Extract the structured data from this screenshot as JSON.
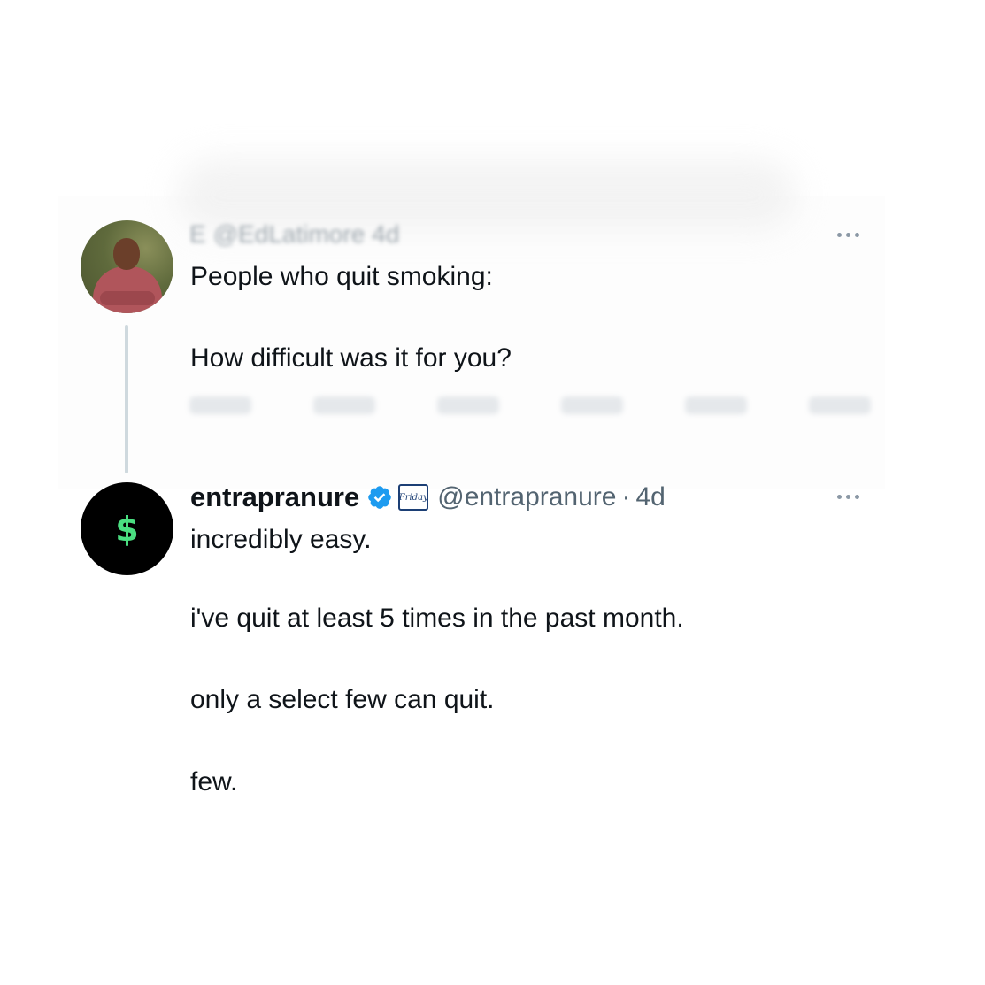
{
  "tweet_1": {
    "header_blurred": {
      "name": "E",
      "handle": "@EdLatimore",
      "time": "4d"
    },
    "body_lines": [
      "People who quit smoking:",
      "How difficult was it for you?"
    ],
    "avatar_icon": "person-photo"
  },
  "tweet_2": {
    "display_name": "entrapranure",
    "verified_icon": "verified-badge-icon",
    "affiliate_badge_text": "Friday",
    "handle": "@entrapranure",
    "separator": "·",
    "time": "4d",
    "avatar_symbol": "$",
    "body_lines": [
      "incredibly easy.",
      "i've quit at least 5 times in the past month.",
      "only a select few can quit.",
      "few."
    ]
  },
  "colors": {
    "text": "#0f1419",
    "secondary": "#536471",
    "verified": "#1d9bf0",
    "thread_line": "#cfd9de",
    "dollar_green": "#4ade80"
  }
}
